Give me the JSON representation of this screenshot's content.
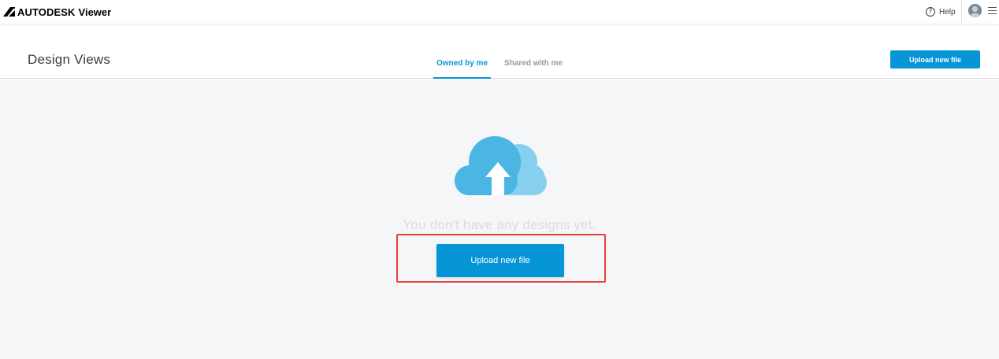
{
  "app": {
    "brand_name": "AUTODESK",
    "product_name": "Viewer",
    "help_label": "Help",
    "help_icon": "question-circle-icon",
    "menu_icon": "hamburger-menu-icon",
    "avatar_icon": "user-avatar-icon"
  },
  "header": {
    "title": "Design Views",
    "tabs": [
      {
        "label": "Owned by me",
        "active": true
      },
      {
        "label": "Shared with me",
        "active": false
      }
    ],
    "upload_label": "Upload new file"
  },
  "main": {
    "illustration": "cloud-upload-icon",
    "empty_message": "You don't have any designs yet.",
    "upload_label": "Upload new file"
  },
  "colors": {
    "accent": "#0696d7",
    "cloud_dark": "#4bb5e3",
    "cloud_light": "#86cfee",
    "background": "#f5f6f8",
    "highlight": "#e8403c"
  }
}
